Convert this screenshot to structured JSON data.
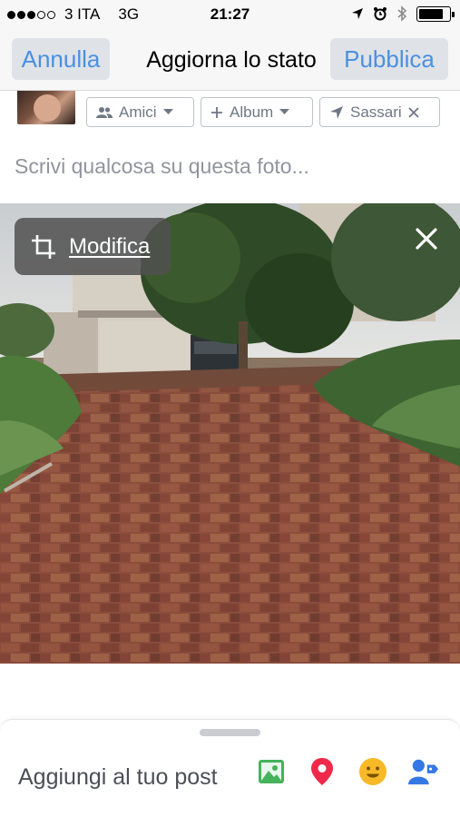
{
  "status_bar": {
    "carrier": "3 ITA",
    "network": "3G",
    "time": "21:27"
  },
  "nav": {
    "cancel_label": "Annulla",
    "title": "Aggiorna lo stato",
    "publish_label": "Pubblica"
  },
  "audience": {
    "friends_label": "Amici",
    "album_label": "Album",
    "location_label": "Sassari"
  },
  "composer": {
    "placeholder": "Scrivi qualcosa su questa foto..."
  },
  "photo": {
    "edit_label": "Modifica"
  },
  "bottom_sheet": {
    "label": "Aggiungi al tuo post"
  },
  "colors": {
    "accent": "#4a90e2",
    "photo_icon": "#44b35a",
    "location_icon": "#f02849",
    "feeling_icon": "#f7b928",
    "tag_icon": "#3578e5"
  },
  "icons": [
    "signal-dots",
    "location-arrow-icon",
    "alarm-icon",
    "bluetooth-icon",
    "battery-icon",
    "friends-icon",
    "plus-icon",
    "chevron-down-icon",
    "location-arrow-icon",
    "close-icon",
    "crop-icon",
    "photo-icon",
    "location-pin-icon",
    "smiley-icon",
    "tag-person-icon"
  ]
}
